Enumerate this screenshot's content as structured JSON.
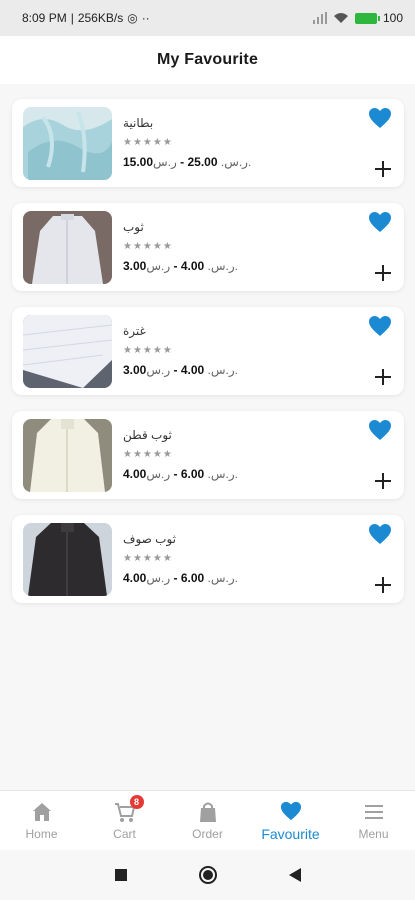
{
  "status_bar": {
    "time": "8:09 PM",
    "speed": "256KB/s",
    "extra": "··",
    "battery": "100"
  },
  "header": {
    "title": "My Favourite"
  },
  "currency": "ر.س.",
  "items": [
    {
      "name": "بطانية",
      "price_low": "15.00",
      "price_high": "25.00",
      "stars": "★★★★★"
    },
    {
      "name": "ثوب",
      "price_low": "3.00",
      "price_high": "4.00",
      "stars": "★★★★★"
    },
    {
      "name": "غترة",
      "price_low": "3.00",
      "price_high": "4.00",
      "stars": "★★★★★"
    },
    {
      "name": "ثوب قطن",
      "price_low": "4.00",
      "price_high": "6.00",
      "stars": "★★★★★"
    },
    {
      "name": "ثوب صوف",
      "price_low": "4.00",
      "price_high": "6.00",
      "stars": "★★★★★"
    }
  ],
  "bottom_nav": {
    "home": "Home",
    "cart": "Cart",
    "cart_badge": "8",
    "order": "Order",
    "favourite": "Favourite",
    "menu": "Menu"
  },
  "colors": {
    "accent": "#1b8ad3",
    "badge": "#e53935"
  }
}
